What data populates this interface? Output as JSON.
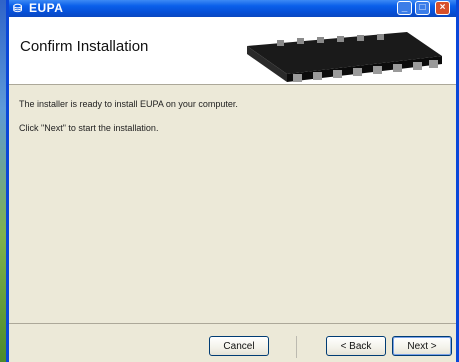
{
  "window": {
    "title": "EUPA",
    "icon": "installer-icon"
  },
  "header": {
    "title": "Confirm Installation"
  },
  "body": {
    "line1": "The installer is ready to install EUPA on your computer.",
    "line2": "Click \"Next\" to start the installation."
  },
  "buttons": {
    "cancel": "Cancel",
    "back": "< Back",
    "next": "Next >"
  },
  "colors": {
    "titlebar": "#0a5fea",
    "header_bg": "#ffffff",
    "dialog_bg": "#ece9d8"
  }
}
